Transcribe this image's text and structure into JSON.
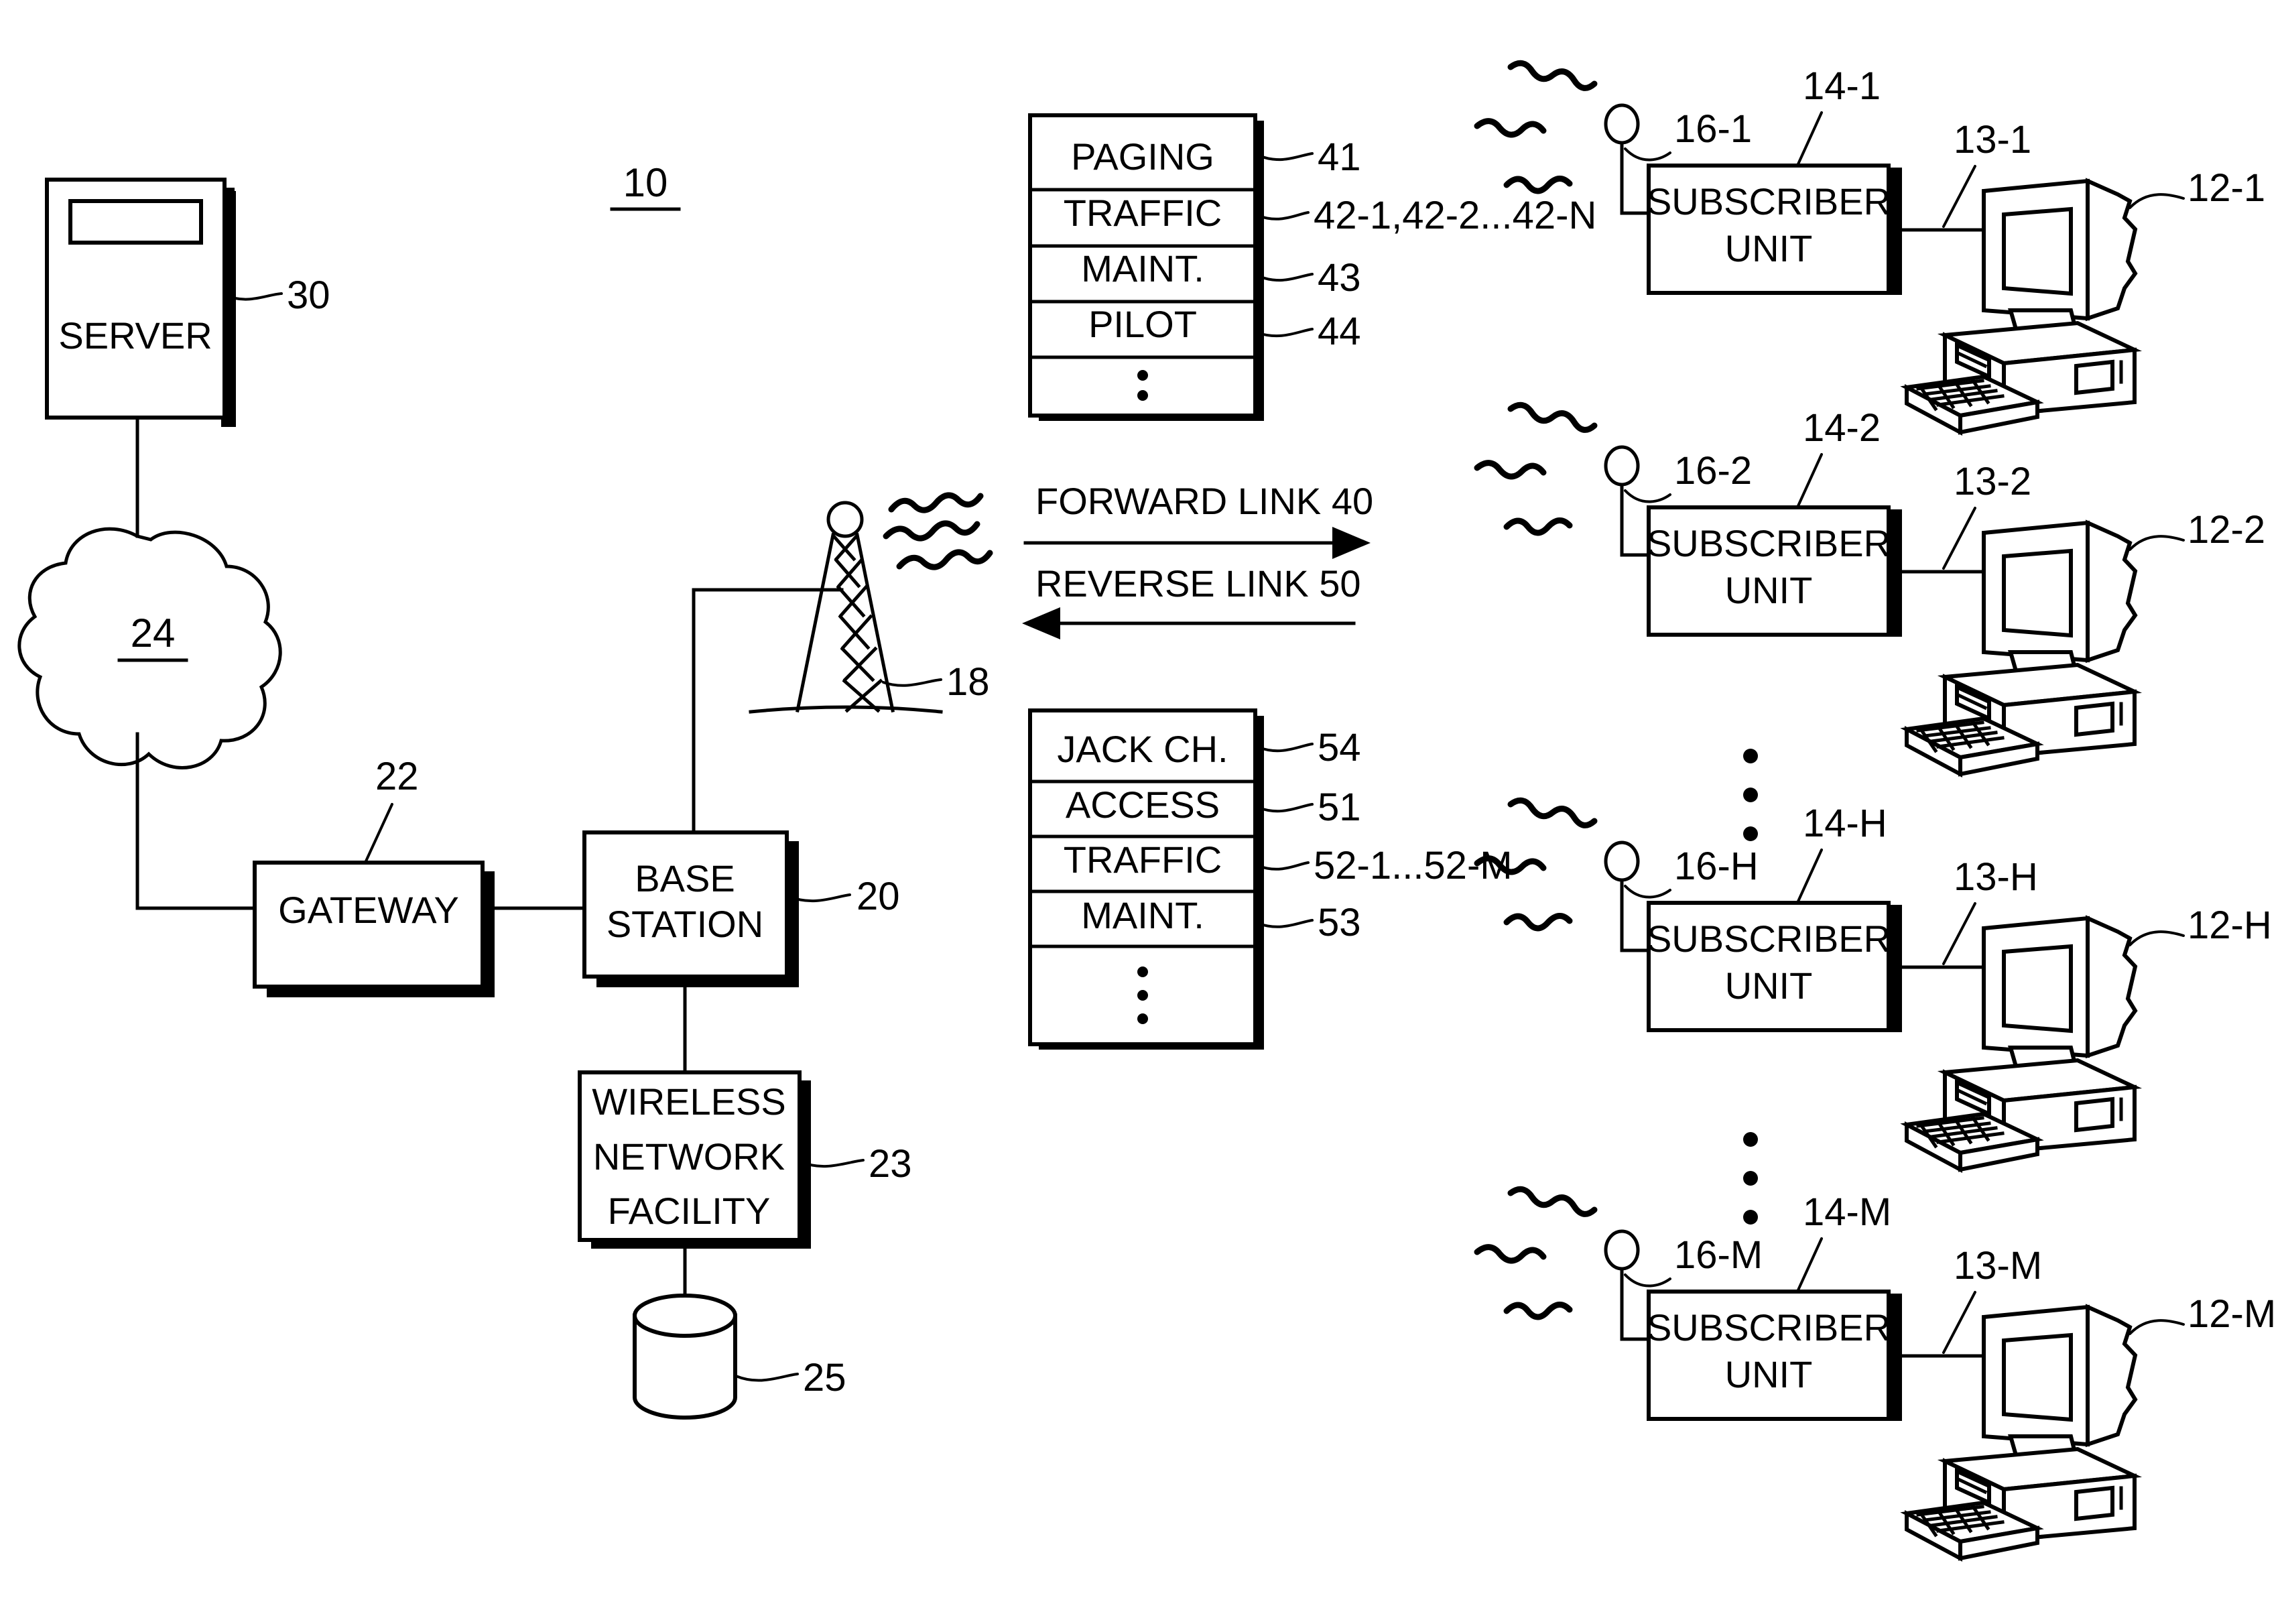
{
  "figure": {
    "number": "10"
  },
  "network": {
    "server": {
      "label": "SERVER",
      "ref": "30"
    },
    "cloud": {
      "ref": "24"
    },
    "gateway": {
      "label": "GATEWAY",
      "ref": "22"
    },
    "base_station": {
      "label_line1": "BASE",
      "label_line2": "STATION",
      "ref": "20"
    },
    "tower": {
      "ref": "18"
    },
    "wireless_network_facility": {
      "label_line1": "WIRELESS",
      "label_line2": "NETWORK",
      "label_line3": "FACILITY",
      "ref": "23"
    },
    "database": {
      "ref": "25"
    }
  },
  "links": {
    "forward": {
      "label": "FORWARD LINK 40",
      "direction": "right"
    },
    "reverse": {
      "label": "REVERSE LINK 50",
      "direction": "left"
    }
  },
  "forward_link_channels": {
    "rows": [
      {
        "name": "PAGING",
        "ref": "41"
      },
      {
        "name": "TRAFFIC",
        "ref": "42-1,42-2...42-N"
      },
      {
        "name": "MAINT.",
        "ref": "43"
      },
      {
        "name": "PILOT",
        "ref": "44"
      }
    ],
    "continuation": "vertical-ellipsis"
  },
  "reverse_link_channels": {
    "rows": [
      {
        "name": "JACK CH.",
        "ref": "54"
      },
      {
        "name": "ACCESS",
        "ref": "51"
      },
      {
        "name": "TRAFFIC",
        "ref": "52-1...52-M"
      },
      {
        "name": "MAINT.",
        "ref": "53"
      }
    ],
    "continuation": "vertical-ellipsis"
  },
  "subscribers": [
    {
      "antenna_ref": "16-1",
      "unit_ref": "14-1",
      "cable_ref": "13-1",
      "computer_ref": "12-1",
      "unit_label_line1": "SUBSCRIBER",
      "unit_label_line2": "UNIT"
    },
    {
      "antenna_ref": "16-2",
      "unit_ref": "14-2",
      "cable_ref": "13-2",
      "computer_ref": "12-2",
      "unit_label_line1": "SUBSCRIBER",
      "unit_label_line2": "UNIT"
    },
    {
      "antenna_ref": "16-H",
      "unit_ref": "14-H",
      "cable_ref": "13-H",
      "computer_ref": "12-H",
      "unit_label_line1": "SUBSCRIBER",
      "unit_label_line2": "UNIT"
    },
    {
      "antenna_ref": "16-M",
      "unit_ref": "14-M",
      "cable_ref": "13-M",
      "computer_ref": "12-M",
      "unit_label_line1": "SUBSCRIBER",
      "unit_label_line2": "UNIT"
    }
  ],
  "colors": {
    "ink": "#000000",
    "paper": "#ffffff"
  }
}
